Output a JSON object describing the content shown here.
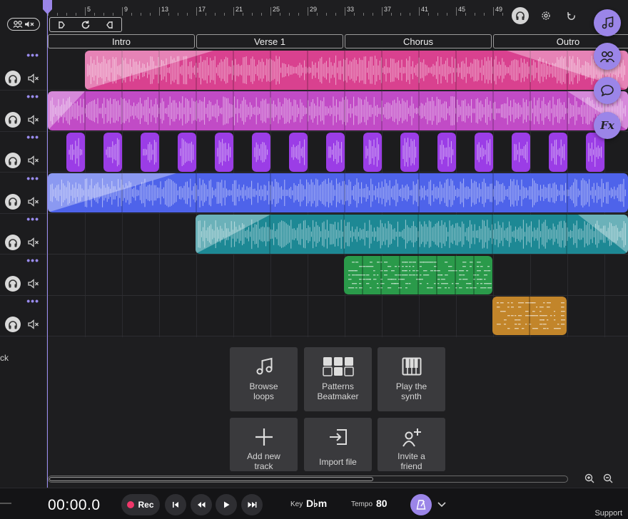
{
  "ruler": {
    "labels": [
      "5",
      "9",
      "13",
      "17",
      "21",
      "25",
      "29",
      "33",
      "37",
      "41",
      "45",
      "49"
    ]
  },
  "sections": [
    {
      "label": "Intro"
    },
    {
      "label": "Verse 1"
    },
    {
      "label": "Chorus"
    },
    {
      "label": "Outro"
    }
  ],
  "tracks": [
    {
      "color": "#d9418f",
      "kind": "wave"
    },
    {
      "color": "#c14bc6",
      "kind": "wave"
    },
    {
      "color": "#9b3de6",
      "kind": "hits"
    },
    {
      "color": "#4e63ea",
      "kind": "wave"
    },
    {
      "color": "#1d8894",
      "kind": "wave"
    },
    {
      "color": "#2a9a4a",
      "kind": "midi"
    },
    {
      "color": "#c2852a",
      "kind": "midi"
    }
  ],
  "left": {
    "add_track_label": "ck"
  },
  "tiles": [
    {
      "label": "Browse\nloops",
      "icon": "music-note-icon"
    },
    {
      "label": "Patterns\nBeatmaker",
      "icon": "grid-icon"
    },
    {
      "label": "Play the\nsynth",
      "icon": "piano-icon"
    },
    {
      "label": "Add new\ntrack",
      "icon": "plus-icon"
    },
    {
      "label": "Import file",
      "icon": "import-icon"
    },
    {
      "label": "Invite a\nfriend",
      "icon": "add-user-icon"
    }
  ],
  "transport": {
    "time": "00:00.0",
    "rec_label": "Rec",
    "key_label": "Key",
    "key_value": "D♭m",
    "tempo_label": "Tempo",
    "tempo_value": "80"
  },
  "support_label": "Support",
  "colors": {
    "accent": "#9b85e8",
    "rec": "#f0376a"
  }
}
